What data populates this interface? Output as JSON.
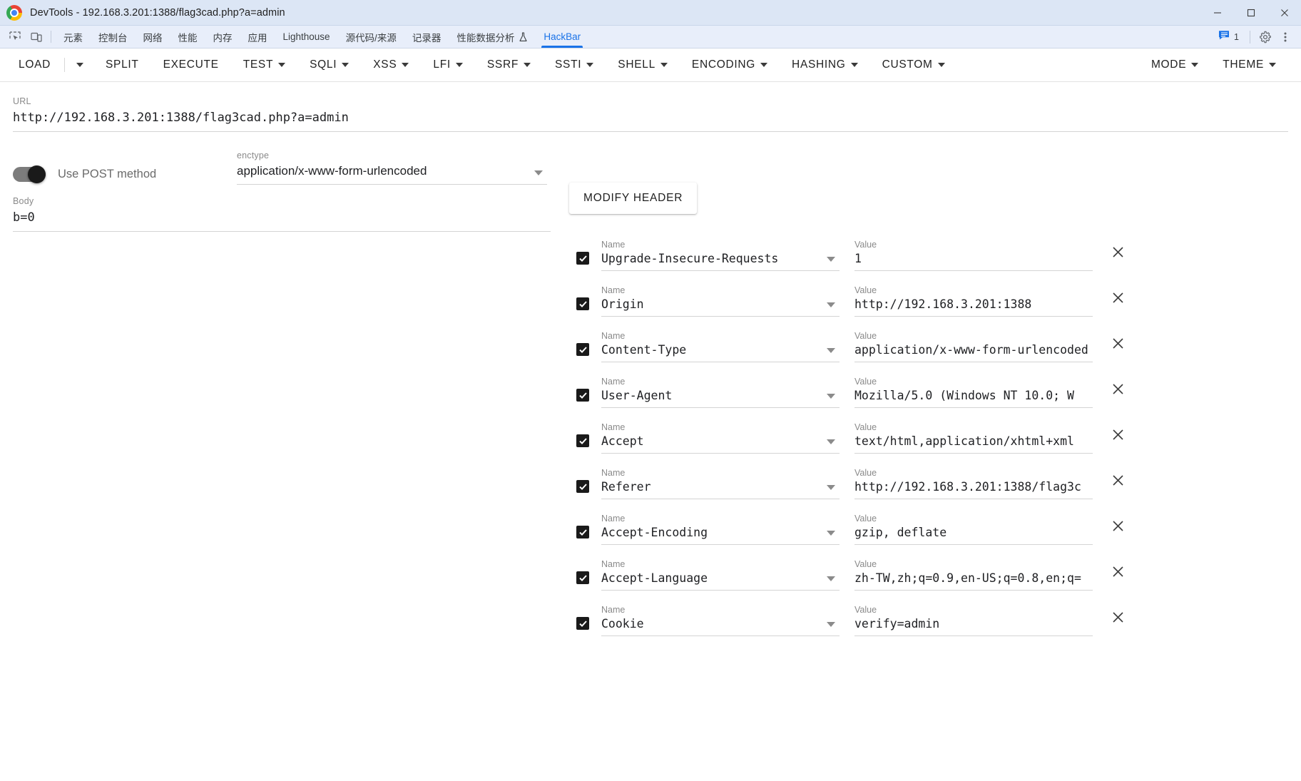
{
  "window": {
    "title": "DevTools - 192.168.3.201:1388/flag3cad.php?a=admin",
    "minimize_label": "Minimize",
    "maximize_label": "Maximize",
    "close_label": "Close"
  },
  "devtools": {
    "tools": [
      {
        "name": "inspect-element-icon",
        "label": "Inspect element"
      },
      {
        "name": "device-toolbar-icon",
        "label": "Toggle device toolbar"
      }
    ],
    "tabs": [
      {
        "label": "元素",
        "active": false,
        "flask": false
      },
      {
        "label": "控制台",
        "active": false,
        "flask": false
      },
      {
        "label": "网络",
        "active": false,
        "flask": false
      },
      {
        "label": "性能",
        "active": false,
        "flask": false
      },
      {
        "label": "内存",
        "active": false,
        "flask": false
      },
      {
        "label": "应用",
        "active": false,
        "flask": false
      },
      {
        "label": "Lighthouse",
        "active": false,
        "flask": false
      },
      {
        "label": "源代码/来源",
        "active": false,
        "flask": false
      },
      {
        "label": "记录器",
        "active": false,
        "flask": false
      },
      {
        "label": "性能数据分析",
        "active": false,
        "flask": true
      },
      {
        "label": "HackBar",
        "active": true,
        "flask": false
      }
    ],
    "issues_count": "1",
    "settings_label": "Settings",
    "more_label": "Customize and control DevTools",
    "accent_color": "#1a73e8"
  },
  "hackbar": {
    "toolbar": [
      {
        "label": "LOAD",
        "caret": false,
        "split_caret": true
      },
      {
        "label": "SPLIT",
        "caret": false,
        "split_caret": false
      },
      {
        "label": "EXECUTE",
        "caret": false,
        "split_caret": false
      },
      {
        "label": "TEST",
        "caret": true,
        "split_caret": false
      },
      {
        "label": "SQLI",
        "caret": true,
        "split_caret": false
      },
      {
        "label": "XSS",
        "caret": true,
        "split_caret": false
      },
      {
        "label": "LFI",
        "caret": true,
        "split_caret": false
      },
      {
        "label": "SSRF",
        "caret": true,
        "split_caret": false
      },
      {
        "label": "SSTI",
        "caret": true,
        "split_caret": false
      },
      {
        "label": "SHELL",
        "caret": true,
        "split_caret": false
      },
      {
        "label": "ENCODING",
        "caret": true,
        "split_caret": false
      },
      {
        "label": "HASHING",
        "caret": true,
        "split_caret": false
      },
      {
        "label": "CUSTOM",
        "caret": true,
        "split_caret": false
      }
    ],
    "toolbar_right": [
      {
        "label": "MODE",
        "caret": true
      },
      {
        "label": "THEME",
        "caret": true
      }
    ],
    "url": {
      "label": "URL",
      "value": "http://192.168.3.201:1388/flag3cad.php?a=admin"
    },
    "post_toggle": {
      "label": "Use POST method",
      "enabled": true
    },
    "enctype": {
      "label": "enctype",
      "value": "application/x-www-form-urlencoded"
    },
    "body": {
      "label": "Body",
      "value": "b=0"
    },
    "modify_header_button": "MODIFY HEADER",
    "header_name_label": "Name",
    "header_value_label": "Value",
    "headers": [
      {
        "checked": true,
        "name": "Upgrade-Insecure-Requests",
        "value": "1"
      },
      {
        "checked": true,
        "name": "Origin",
        "value": "http://192.168.3.201:1388"
      },
      {
        "checked": true,
        "name": "Content-Type",
        "value": "application/x-www-form-urlencoded"
      },
      {
        "checked": true,
        "name": "User-Agent",
        "value": "Mozilla/5.0 (Windows NT 10.0; W"
      },
      {
        "checked": true,
        "name": "Accept",
        "value": "text/html,application/xhtml+xml"
      },
      {
        "checked": true,
        "name": "Referer",
        "value": "http://192.168.3.201:1388/flag3c"
      },
      {
        "checked": true,
        "name": "Accept-Encoding",
        "value": "gzip, deflate"
      },
      {
        "checked": true,
        "name": "Accept-Language",
        "value": "zh-TW,zh;q=0.9,en-US;q=0.8,en;q="
      },
      {
        "checked": true,
        "name": "Cookie",
        "value": "verify=admin"
      }
    ],
    "remove_header_label": "Remove header"
  }
}
